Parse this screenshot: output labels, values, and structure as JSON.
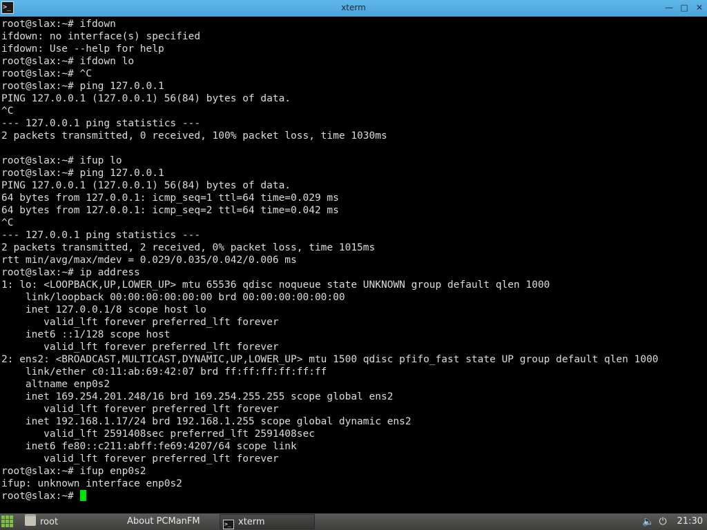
{
  "window": {
    "title": "xterm",
    "buttons": {
      "minimize": "—",
      "maximize": "□",
      "close": "✕"
    }
  },
  "terminal": {
    "lines": [
      "root@slax:~# ifdown",
      "ifdown: no interface(s) specified",
      "ifdown: Use --help for help",
      "root@slax:~# ifdown lo",
      "root@slax:~# ^C",
      "root@slax:~# ping 127.0.0.1",
      "PING 127.0.0.1 (127.0.0.1) 56(84) bytes of data.",
      "^C",
      "--- 127.0.0.1 ping statistics ---",
      "2 packets transmitted, 0 received, 100% packet loss, time 1030ms",
      "",
      "root@slax:~# ifup lo",
      "root@slax:~# ping 127.0.0.1",
      "PING 127.0.0.1 (127.0.0.1) 56(84) bytes of data.",
      "64 bytes from 127.0.0.1: icmp_seq=1 ttl=64 time=0.029 ms",
      "64 bytes from 127.0.0.1: icmp_seq=2 ttl=64 time=0.042 ms",
      "^C",
      "--- 127.0.0.1 ping statistics ---",
      "2 packets transmitted, 2 received, 0% packet loss, time 1015ms",
      "rtt min/avg/max/mdev = 0.029/0.035/0.042/0.006 ms",
      "root@slax:~# ip address",
      "1: lo: <LOOPBACK,UP,LOWER_UP> mtu 65536 qdisc noqueue state UNKNOWN group default qlen 1000",
      "    link/loopback 00:00:00:00:00:00 brd 00:00:00:00:00:00",
      "    inet 127.0.0.1/8 scope host lo",
      "       valid_lft forever preferred_lft forever",
      "    inet6 ::1/128 scope host",
      "       valid_lft forever preferred_lft forever",
      "2: ens2: <BROADCAST,MULTICAST,DYNAMIC,UP,LOWER_UP> mtu 1500 qdisc pfifo_fast state UP group default qlen 1000",
      "    link/ether c0:11:ab:69:42:07 brd ff:ff:ff:ff:ff:ff",
      "    altname enp0s2",
      "    inet 169.254.201.248/16 brd 169.254.255.255 scope global ens2",
      "       valid_lft forever preferred_lft forever",
      "    inet 192.168.1.17/24 brd 192.168.1.255 scope global dynamic ens2",
      "       valid_lft 2591408sec preferred_lft 2591408sec",
      "    inet6 fe80::c211:abff:fe69:4207/64 scope link",
      "       valid_lft forever preferred_lft forever",
      "root@slax:~# ifup enp0s2",
      "ifup: unknown interface enp0s2"
    ],
    "prompt": "root@slax:~# ",
    "cursor_color": "#00e000"
  },
  "taskbar": {
    "tasks": [
      {
        "label": "root",
        "icon": "folder-icon"
      },
      {
        "label": "About PCManFM",
        "icon": ""
      },
      {
        "label": "xterm",
        "icon": "terminal-icon"
      }
    ],
    "clock": "21:30",
    "tray": {
      "volume_icon": "🔈",
      "power_icon": "⏻"
    },
    "start_color": "#7cc241"
  }
}
